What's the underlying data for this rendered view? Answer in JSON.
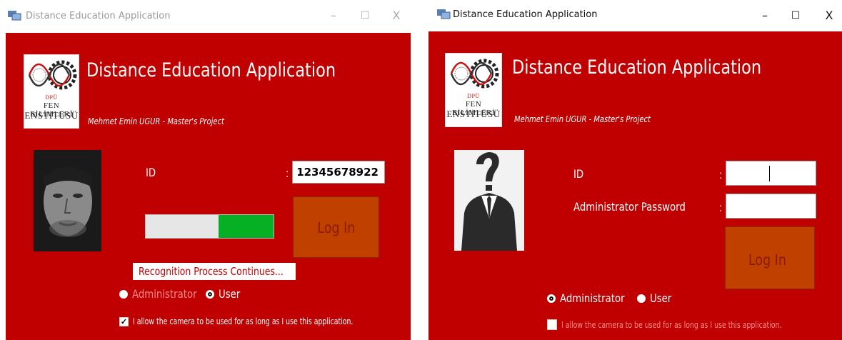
{
  "colors": {
    "body_background": "#c00000",
    "login_button_bg": "#c04000",
    "login_button_text": "#8a1a00",
    "progress_fill": "#06b025",
    "inactive_text": "#ff8a8a"
  },
  "left_window": {
    "title": "Distance Education Application",
    "controls": {
      "minimize": "–",
      "maximize": "☐",
      "close": "X"
    },
    "logo": {
      "line1": "DPÜ",
      "line2": "FEN BİLİMLERİ",
      "line3": "ENSTİTÜSÜ"
    },
    "heading": "Distance Education Application",
    "subheading": "Mehmet Emin UGUR - Master's Project",
    "photo_icon": "face-photo",
    "id_label": "ID",
    "colon": ":",
    "id_value": "12345678922",
    "progress_percent": 47,
    "login_label": "Log In",
    "status_text": "Recognition Process Continues...",
    "radio_admin_label": "Administrator",
    "radio_user_label": "User",
    "selected_role": "User",
    "checkbox_checked": true,
    "checkbox_label": "I allow the camera to be used for as long as I use this application."
  },
  "right_window": {
    "title": "Distance Education Application",
    "controls": {
      "minimize": "–",
      "maximize": "☐",
      "close": "X"
    },
    "logo": {
      "line1": "DPÜ",
      "line2": "FEN BİLİMLERİ",
      "line3": "ENSTİTÜSÜ"
    },
    "heading": "Distance Education Application",
    "subheading": "Mehmet Emin UGUR - Master's Project",
    "photo_icon": "anonymous-person-icon",
    "id_label": "ID",
    "password_label": "Administrator Password",
    "colon": ":",
    "id_value": "",
    "password_value": "",
    "login_label": "Log In",
    "radio_admin_label": "Administrator",
    "radio_user_label": "User",
    "selected_role": "Administrator",
    "checkbox_checked": false,
    "checkbox_label": "I allow the camera to be used for as long as I use this application."
  }
}
